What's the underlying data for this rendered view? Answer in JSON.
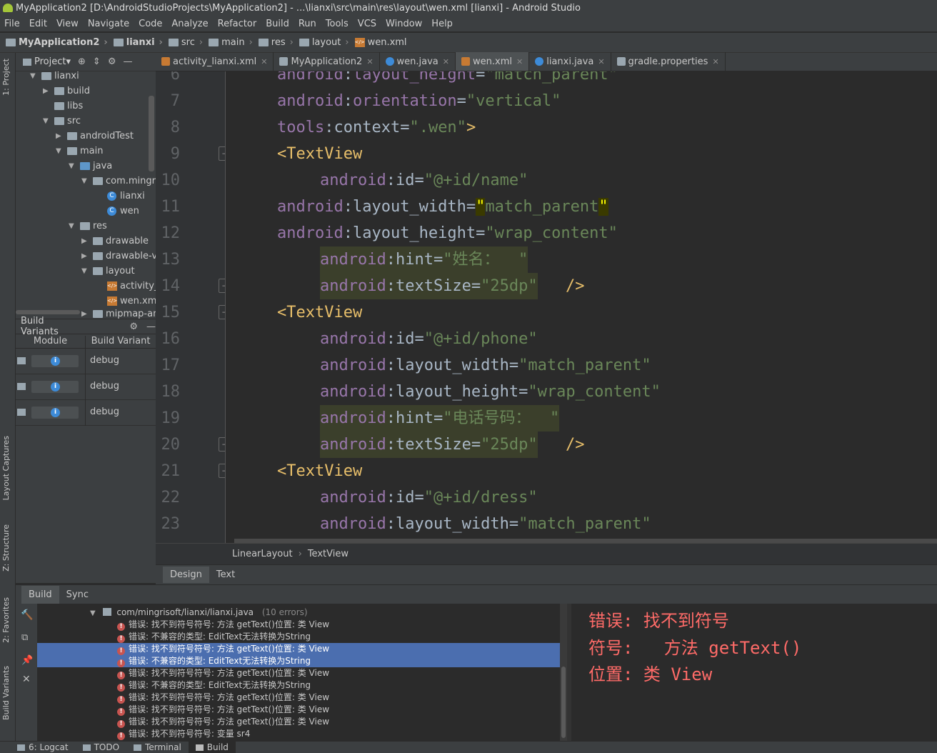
{
  "window": {
    "title": "MyApplication2 [D:\\AndroidStudioProjects\\MyApplication2] - ...\\lianxi\\src\\main\\res\\layout\\wen.xml [lianxi] - Android Studio"
  },
  "menu": [
    "File",
    "Edit",
    "View",
    "Navigate",
    "Code",
    "Analyze",
    "Refactor",
    "Build",
    "Run",
    "Tools",
    "VCS",
    "Window",
    "Help"
  ],
  "nav": [
    "MyApplication2",
    "lianxi",
    "src",
    "main",
    "res",
    "layout",
    "wen.xml"
  ],
  "left_strip": {
    "project": "1: Project",
    "layout_captures": "Layout Captures",
    "structure": "Z: Structure",
    "favorites": "2: Favorites",
    "build_variants": "Build Variants"
  },
  "project_panel": {
    "title": "Project▾",
    "tree": [
      {
        "label": "lianxi",
        "kind": "module"
      },
      {
        "label": "build",
        "kind": "folder"
      },
      {
        "label": "libs",
        "kind": "folder"
      },
      {
        "label": "src",
        "kind": "folder"
      },
      {
        "label": "androidTest",
        "kind": "folder"
      },
      {
        "label": "main",
        "kind": "folder"
      },
      {
        "label": "java",
        "kind": "folder"
      },
      {
        "label": "com.mingris",
        "kind": "package"
      },
      {
        "label": "lianxi",
        "kind": "class"
      },
      {
        "label": "wen",
        "kind": "class"
      },
      {
        "label": "res",
        "kind": "folder"
      },
      {
        "label": "drawable",
        "kind": "folder"
      },
      {
        "label": "drawable-v",
        "kind": "folder"
      },
      {
        "label": "layout",
        "kind": "folder"
      },
      {
        "label": "activity_li",
        "kind": "xml"
      },
      {
        "label": "wen.xml",
        "kind": "xml"
      },
      {
        "label": "mipmap-an",
        "kind": "folder"
      }
    ]
  },
  "build_variants": {
    "title": "Build Variants",
    "col_module": "Module",
    "col_variant": "Build Variant",
    "rows": [
      {
        "variant": "debug"
      },
      {
        "variant": "debug"
      },
      {
        "variant": "debug"
      }
    ]
  },
  "tabs": [
    {
      "label": "activity_lianxi.xml",
      "icon_color": "#c77a33"
    },
    {
      "label": "MyApplication2",
      "icon_color": "#9aa7b0"
    },
    {
      "label": "wen.java",
      "icon_color": "#3d8bd8"
    },
    {
      "label": "wen.xml",
      "icon_color": "#c77a33",
      "active": true
    },
    {
      "label": "lianxi.java",
      "icon_color": "#3d8bd8"
    },
    {
      "label": "gradle.properties",
      "icon_color": "#9aa7b0"
    }
  ],
  "code_lines": [
    {
      "n": "6",
      "text": "android:layout_height=\"match_parent\""
    },
    {
      "n": "7",
      "text": "android:orientation=\"vertical\""
    },
    {
      "n": "8",
      "text": "tools:context=\".wen\">"
    },
    {
      "n": "9",
      "text": "<TextView"
    },
    {
      "n": "10",
      "text": "android:id=\"@+id/name\""
    },
    {
      "n": "11",
      "text": "android:layout_width=\"match_parent\""
    },
    {
      "n": "12",
      "text": "android:layout_height=\"wrap_content\""
    },
    {
      "n": "13",
      "text": "android:hint=\"姓名：\""
    },
    {
      "n": "14",
      "text": "android:textSize=\"25dp\"/>"
    },
    {
      "n": "15",
      "text": "<TextView"
    },
    {
      "n": "16",
      "text": "android:id=\"@+id/phone\""
    },
    {
      "n": "17",
      "text": "android:layout_width=\"match_parent\""
    },
    {
      "n": "18",
      "text": "android:layout_height=\"wrap_content\""
    },
    {
      "n": "19",
      "text": "android:hint=\"电话号码：\""
    },
    {
      "n": "20",
      "text": "android:textSize=\"25dp\"/>"
    },
    {
      "n": "21",
      "text": "<TextView"
    },
    {
      "n": "22",
      "text": "android:id=\"@+id/dress\""
    },
    {
      "n": "23",
      "text": "android:layout_width=\"match_parent\""
    }
  ],
  "editor_breadcrumb": [
    "LinearLayout",
    "TextView"
  ],
  "design_tabs": [
    "Design",
    "Text"
  ],
  "build_panel": {
    "tabs": [
      "Build",
      "Sync"
    ],
    "file_node": "com/mingrisoft/lianxi/lianxi.java",
    "error_count": "(10 errors)",
    "errors": [
      "错误: 找不到符号符号:   方法 getText()位置: 类 View",
      "错误: 不兼容的类型: EditText无法转换为String",
      "错误: 找不到符号符号:   方法 getText()位置: 类 View",
      "错误: 不兼容的类型: EditText无法转换为String",
      "错误: 找不到符号符号:   方法 getText()位置: 类 View",
      "错误: 不兼容的类型: EditText无法转换为String",
      "错误: 找不到符号符号:   方法 getText()位置: 类 View",
      "错误: 找不到符号符号:   方法 getText()位置: 类 View",
      "错误: 找不到符号符号:   方法 getText()位置: 类 View",
      "错误: 找不到符号符号: 变量 sr4"
    ],
    "detail": [
      "错误: 找不到符号",
      "符号:   方法 getText()",
      "位置: 类 View"
    ]
  },
  "status_tabs": [
    "6: Logcat",
    "TODO",
    "Terminal",
    "Build"
  ]
}
